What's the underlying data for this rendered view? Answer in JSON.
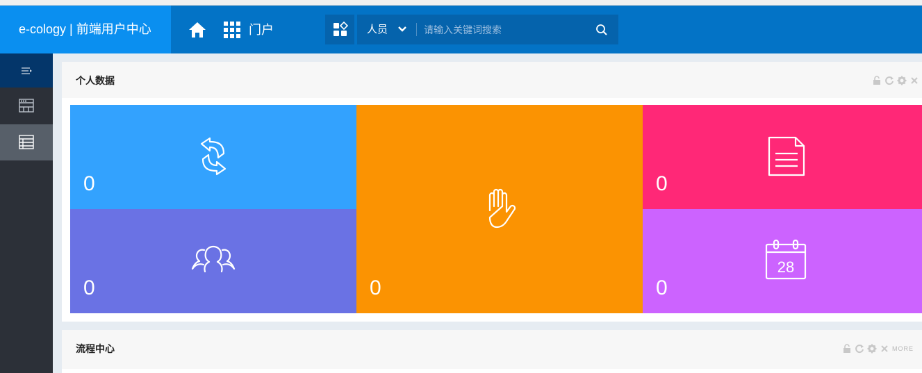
{
  "header": {
    "brand": "e-cology | 前端用户中心",
    "portal_label": "门户",
    "search": {
      "type_label": "人员",
      "placeholder": "请输入关键词搜索"
    }
  },
  "panels": [
    {
      "title": "个人数据",
      "tiles": [
        {
          "name": "workflow-transfer",
          "value": "0",
          "icon": "sync-arrows-icon",
          "color": "#33a2fe"
        },
        {
          "name": "pending-approval",
          "value": "0",
          "icon": "hand-icon",
          "color": "#fb9302"
        },
        {
          "name": "documents",
          "value": "0",
          "icon": "document-icon",
          "color": "#ff2877"
        },
        {
          "name": "collaboration",
          "value": "0",
          "icon": "people-group-icon",
          "color": "#6a72e4"
        },
        {
          "name": "calendar",
          "value": "0",
          "icon": "calendar-icon",
          "color": "#cc63ff",
          "icon_text": "28"
        }
      ]
    },
    {
      "title": "流程中心",
      "more_label": "MORE"
    }
  ],
  "colors": {
    "header": "#0373c6",
    "brand_bg": "#0a8ff0",
    "sidebar": "#2c3038",
    "sidebar_active": "#575f69"
  }
}
